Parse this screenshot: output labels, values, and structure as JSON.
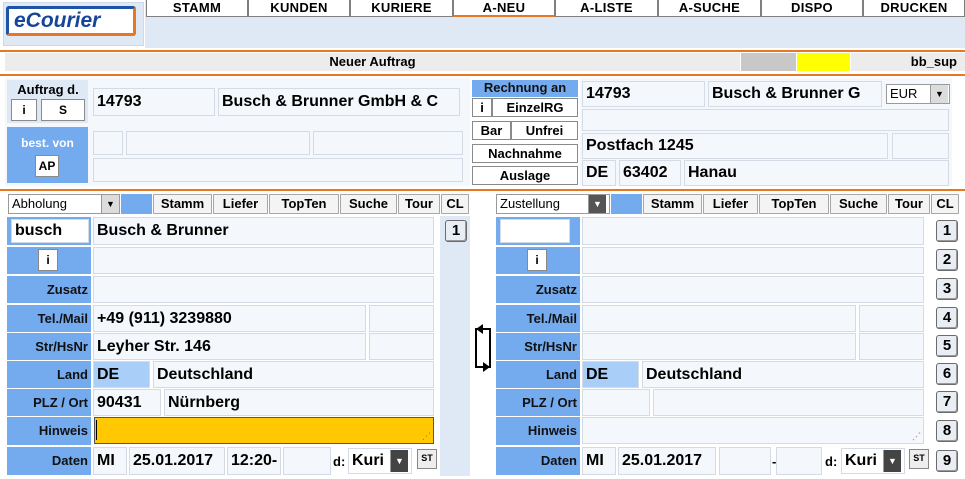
{
  "logo": {
    "text": "eCourier"
  },
  "nav": [
    "STAMM",
    "KUNDEN",
    "KURIERE",
    "A-NEU",
    "A-LISTE",
    "A-SUCHE",
    "DISPO",
    "DRUCKEN"
  ],
  "title_bar": {
    "title": "Neuer Auftrag",
    "user": "bb_sup"
  },
  "auftraggeber": {
    "label": "Auftrag d.",
    "btn_i": "i",
    "btn_s": "S",
    "customer_no": "14793",
    "customer_name": "Busch & Brunner GmbH & C",
    "best_von_label": "best. von",
    "ap_btn": "AP"
  },
  "rechnung": {
    "header": "Rechnung an",
    "btn_i": "i",
    "einzelrg": "EinzelRG",
    "bar": "Bar",
    "unfrei": "Unfrei",
    "nachnahme": "Nachnahme",
    "auslage": "Auslage",
    "customer_no": "14793",
    "customer_name": "Busch & Brunner G",
    "currency": "EUR",
    "street": "Postfach 1245",
    "country": "DE",
    "zip": "63402",
    "city": "Hanau"
  },
  "abholung": {
    "dropdown": "Abholung",
    "buttons": [
      "Stamm",
      "Liefer",
      "TopTen",
      "Suche",
      "Tour",
      "CL"
    ],
    "search": "busch",
    "name": "Busch & Brunner",
    "labels": {
      "i": "i",
      "zusatz": "Zusatz",
      "tel": "Tel./Mail",
      "str": "Str/HsNr",
      "land": "Land",
      "plz": "PLZ / Ort",
      "hinweis": "Hinweis",
      "daten": "Daten"
    },
    "tel": "+49 (911) 3239880",
    "street": "Leyher Str. 146",
    "country_code": "DE",
    "country_name": "Deutschland",
    "zip": "90431",
    "city": "Nürnberg",
    "day": "MI",
    "date": "25.01.2017",
    "time": "12:20-",
    "d_label": "d:",
    "kuri": "Kuri",
    "st": "ST",
    "num_btn": "1"
  },
  "zustellung": {
    "dropdown": "Zustellung",
    "buttons": [
      "Stamm",
      "Liefer",
      "TopTen",
      "Suche",
      "Tour",
      "CL"
    ],
    "labels": {
      "i": "i",
      "zusatz": "Zusatz",
      "tel": "Tel./Mail",
      "str": "Str/HsNr",
      "land": "Land",
      "plz": "PLZ / Ort",
      "hinweis": "Hinweis",
      "daten": "Daten"
    },
    "country_code": "DE",
    "country_name": "Deutschland",
    "day": "MI",
    "date": "25.01.2017",
    "dash": "-",
    "d_label": "d:",
    "kuri": "Kuri",
    "st": "ST",
    "num_btns": [
      "1",
      "2",
      "3",
      "4",
      "5",
      "6",
      "7",
      "8",
      "9"
    ]
  },
  "colors": {
    "accent": "#e87722",
    "label_blue": "#74aaee",
    "hinweis_yellow": "#ffc800",
    "highlight_yellow": "#ffff00"
  },
  "icons": {
    "swap": "swap-icon"
  }
}
